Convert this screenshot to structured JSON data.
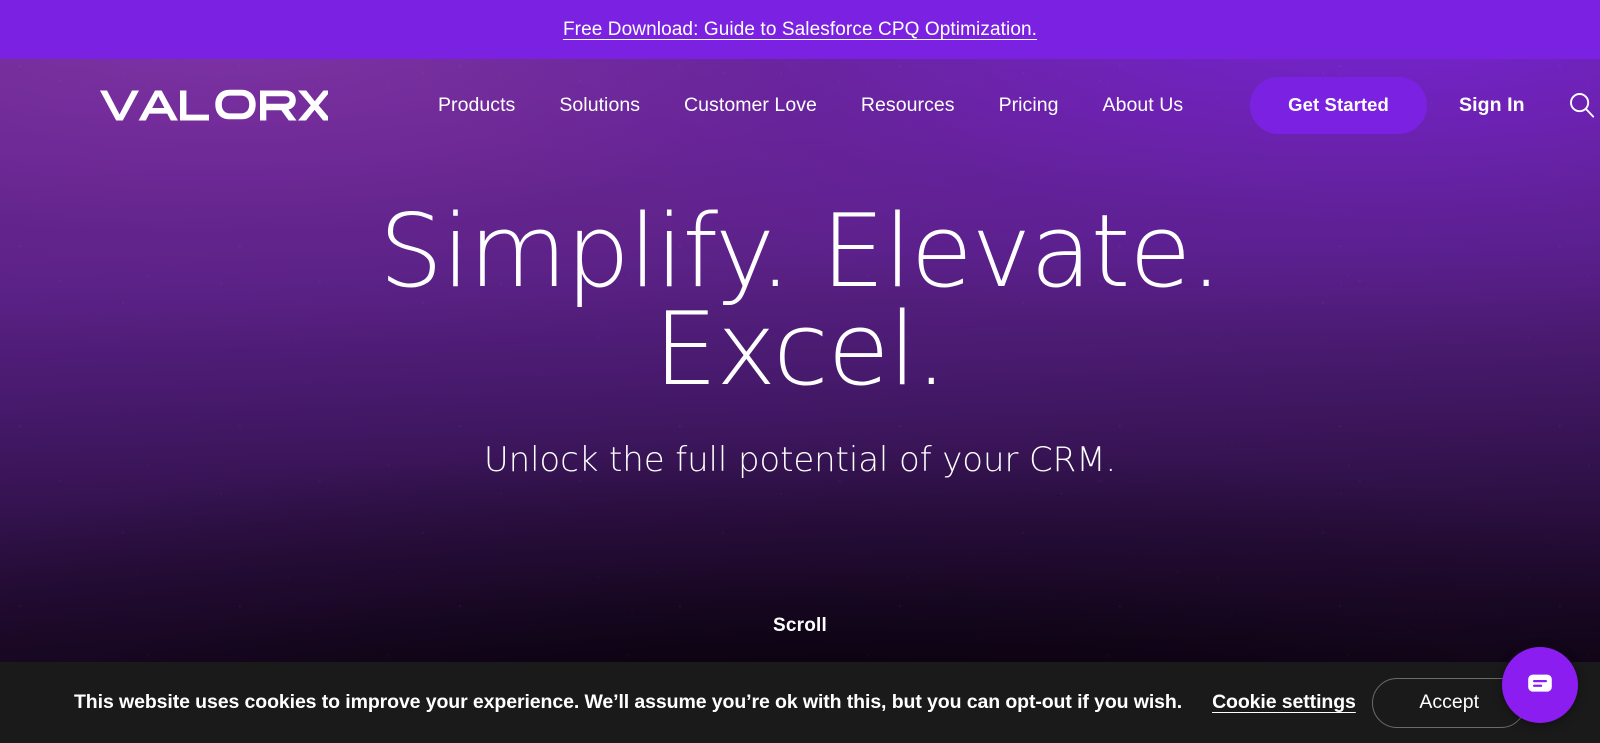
{
  "promo_banner": {
    "text": "Free Download: Guide to Salesforce CPQ Optimization.",
    "background_color": "#7B22E2",
    "text_color": "#FFFFFF"
  },
  "navbar": {
    "logo_text": "VALORX",
    "links": [
      {
        "label": "Products"
      },
      {
        "label": "Solutions"
      },
      {
        "label": "Customer Love"
      },
      {
        "label": "Resources"
      },
      {
        "label": "Pricing"
      },
      {
        "label": "About Us"
      }
    ],
    "cta_label": "Get Started",
    "cta_color": "#7B22E2",
    "sign_in_label": "Sign In",
    "search_icon": "search-icon"
  },
  "hero": {
    "title_line_1": "Simplify. Elevate.",
    "title_line_2": "Excel.",
    "subtitle": "Unlock the full potential of your CRM.",
    "scroll_label": "Scroll",
    "gradient_top_color": "#6E2A91",
    "gradient_bottom_color": "#050208"
  },
  "cookie_bar": {
    "message": "This website uses cookies to improve your experience. We’ll assume you’re ok with this, but you can opt-out if you wish.",
    "settings_label": "Cookie settings",
    "accept_label": "Accept",
    "background_color": "#1A1A1A"
  },
  "chat_widget": {
    "icon": "chat-bubble-icon",
    "background_color": "#8B1DF0"
  }
}
